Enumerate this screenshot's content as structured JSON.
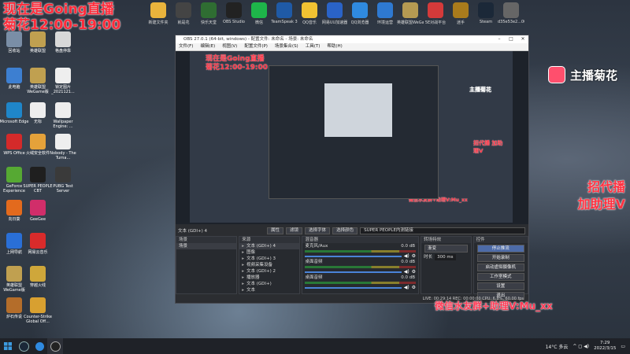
{
  "overlay": {
    "line1": "现在是Going直播",
    "line2": "菊花12:00-19:00",
    "streamer_badge": "主播菊花",
    "ad_line1": "招代播",
    "ad_line2": "加助理V",
    "wechat_line": "微信水友群+助理V:Mu_xx"
  },
  "top_icons": [
    {
      "label": "新建文件夹",
      "color": "#e9b33c"
    },
    {
      "label": "就是花",
      "color": "#444"
    },
    {
      "label": "快乐天堂",
      "color": "#2f6d32"
    },
    {
      "label": "OBS Studio",
      "color": "#222"
    },
    {
      "label": "微信",
      "color": "#1eb54a"
    },
    {
      "label": "TeamSpeak 3",
      "color": "#1f5aa6"
    },
    {
      "label": "QQ音乐",
      "color": "#f1c232"
    },
    {
      "label": "网易UU加速器",
      "color": "#2a63c7"
    },
    {
      "label": "QQ浏览器",
      "color": "#2f8ae0"
    },
    {
      "label": "环境运营",
      "color": "#2e79d1"
    },
    {
      "label": "英雄联盟WeGame平台",
      "color": "#b59a52"
    },
    {
      "label": "5E对战平台",
      "color": "#d43a3a"
    },
    {
      "label": "迷手",
      "color": "#a97b1c"
    },
    {
      "label": "Steam",
      "color": "#1b2838"
    },
    {
      "label": "d35e53e2...001213",
      "color": "#666"
    }
  ],
  "left_icons": [
    {
      "label": "回收站",
      "color": "#7a8ea6"
    },
    {
      "label": "英雄联盟",
      "color": "#c0a050"
    },
    {
      "label": "格盘停靠",
      "color": "#d8d8d8"
    },
    {
      "label": "此电脑",
      "color": "#3d7fd1"
    },
    {
      "label": "英雄联盟WeGame版",
      "color": "#c0a050"
    },
    {
      "label": "锁定图片_2021121...",
      "color": "#eeeeee"
    },
    {
      "label": "Microsoft Edge",
      "color": "#1f86c9"
    },
    {
      "label": "无标",
      "color": "#eeeeee"
    },
    {
      "label": "Wallpaper Engine: ...",
      "color": "#eeeeee"
    },
    {
      "label": "WPS Office",
      "color": "#d42a2a"
    },
    {
      "label": "火绒安全软件",
      "color": "#e5a23a"
    },
    {
      "label": "Nobody - The Turna...",
      "color": "#eeeeee"
    },
    {
      "label": "GeForce Experience",
      "color": "#56a933"
    },
    {
      "label": "SUPER PEOPLE CBT",
      "color": "#1f1f1f"
    },
    {
      "label": "PUBG Test Server",
      "color": "#3a3a3a"
    },
    {
      "label": "向日葵",
      "color": "#e36a1d"
    },
    {
      "label": "GeeGee",
      "color": "#d12e6a"
    },
    {
      "label": "上网导航",
      "color": "#2a6fd6"
    },
    {
      "label": "网易云音乐",
      "color": "#d92b2b"
    },
    {
      "label": "英雄联盟WeGame版",
      "color": "#c0a050"
    },
    {
      "label": "穿越火线",
      "color": "#cfa73a"
    },
    {
      "label": "炉石传说",
      "color": "#b46d2a"
    },
    {
      "label": "Counter-Strike Global Off...",
      "color": "#d8a030"
    }
  ],
  "obs": {
    "title": "OBS 27.0.1 (64-bit, windows) - 配置文件: 未命名 - 场景: 未命名",
    "menu": [
      "文件(F)",
      "编辑(E)",
      "视图(V)",
      "配置文件(P)",
      "场景集合(S)",
      "工具(T)",
      "帮助(H)"
    ],
    "source_bar": {
      "current": "文本 (GDI+) 4",
      "properties": "属性",
      "filters": "滤镜",
      "font": "选择字体",
      "color": "选择颜色",
      "text_value": "SUPER PEOPLE内测链接"
    },
    "docks": {
      "scenes_title": "场景",
      "scene_item": "场景",
      "sources_title": "来源",
      "sources": [
        "文本 (GDI+) 4",
        "图像",
        "文本 (GDI+) 3",
        "视频采集设备",
        "文本 (GDI+) 2",
        "播放器",
        "文本 (GDI+)",
        "文本"
      ],
      "mixer_title": "混音器",
      "mixer_tracks": [
        {
          "name": "麦克风/Aux",
          "db": "0.0 dB"
        },
        {
          "name": "桌面音频",
          "db": "0.0 dB"
        },
        {
          "name": "桌面音频",
          "db": "0.0 dB"
        }
      ],
      "transitions_title": "转场特效",
      "transition": "渐变",
      "duration_label": "时长",
      "duration_value": "300 ms",
      "controls_title": "控件",
      "controls": [
        "停止推流",
        "开始录制",
        "启动虚拟摄像机",
        "工作室模式",
        "设置",
        "退出"
      ]
    },
    "status": "LIVE: 00:29:14   REC: 00:00:00   CPU: 6.8%, 60.00 fps"
  },
  "nested": {
    "line1": "现在是Going直播",
    "line2": "菊花12:00-19:00",
    "badge": "主播菊花",
    "ad": "招代播 加助理V",
    "wechat": "微信水友群+助理V:Mu_xx"
  },
  "taskbar": {
    "weather": "14°C 多云",
    "time": "7:29",
    "date": "2022/3/15"
  }
}
